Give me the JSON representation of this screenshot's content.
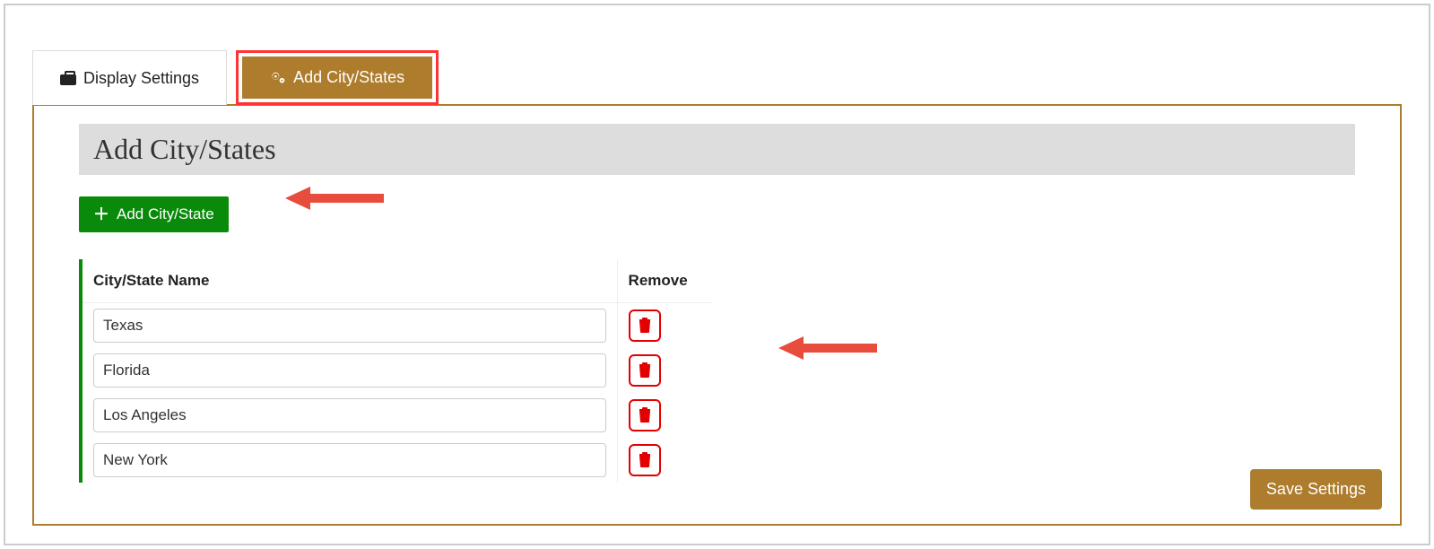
{
  "tabs": {
    "display_settings": "Display Settings",
    "add_city_states": "Add City/States"
  },
  "panel": {
    "title": "Add City/States",
    "add_button_label": "Add City/State",
    "save_button_label": "Save Settings"
  },
  "table": {
    "header_name": "City/State Name",
    "header_remove": "Remove",
    "rows": [
      {
        "value": "Texas"
      },
      {
        "value": "Florida"
      },
      {
        "value": "Los Angeles"
      },
      {
        "value": "New York"
      }
    ]
  },
  "colors": {
    "accent_brown": "#AD7C2D",
    "add_green": "#0a8a0a",
    "delete_red": "#e30000",
    "highlight_red": "#f33"
  }
}
